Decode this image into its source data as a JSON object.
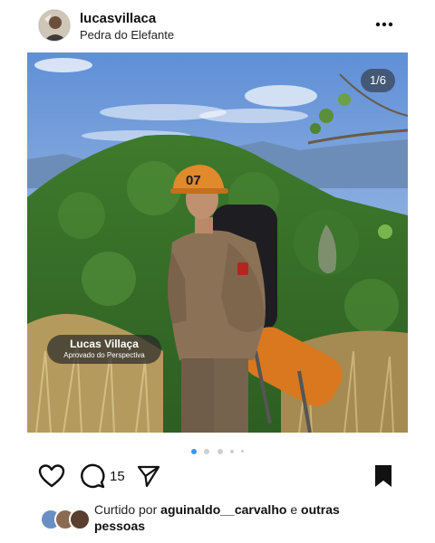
{
  "post": {
    "username": "lucasvillaca",
    "location": "Pedra do Elefante",
    "image_counter": "1/6",
    "helmet_number": "07",
    "caption_name": "Lucas Villaça",
    "caption_sub": "Aprovado do Perspectiva",
    "carousel": {
      "total_dots": 5,
      "active_index": 0
    }
  },
  "actions": {
    "like_icon": "heart-icon",
    "comment_icon": "comment-icon",
    "comment_count": "15",
    "share_icon": "send-icon",
    "save_icon": "bookmark-icon"
  },
  "likes": {
    "prefix": "Curtido por ",
    "user": "aguinaldo__carvalho",
    "joiner": " e ",
    "others": "outras pessoas"
  },
  "colors": {
    "accent": "#3897f0",
    "text": "#111111"
  }
}
